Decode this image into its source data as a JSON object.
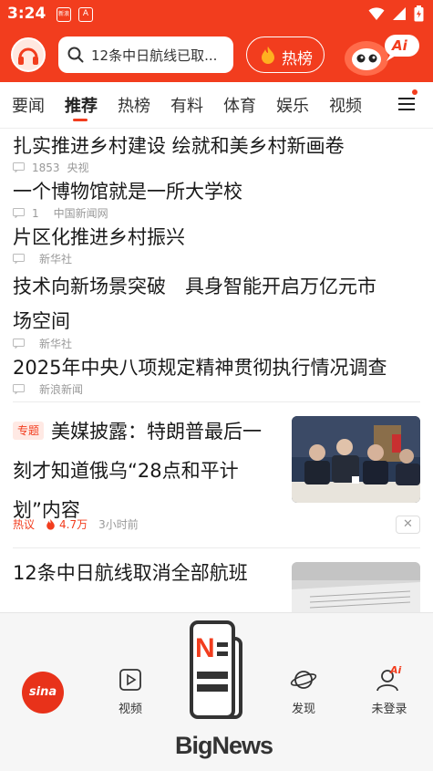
{
  "status_bar": {
    "time": "3:24",
    "app_icon_1": "新浪",
    "app_icon_2": "A"
  },
  "header": {
    "search_text": "12条中日航线已取...",
    "hot_label": "热榜",
    "ai_badge": "Ai"
  },
  "tabs": [
    "要闻",
    "推荐",
    "热榜",
    "有料",
    "体育",
    "娱乐",
    "视频"
  ],
  "active_tab": "推荐",
  "news": [
    {
      "title": "扎实推进乡村建设 绘就和美乡村新画卷",
      "comments": "1853",
      "source": "央视"
    },
    {
      "title": "一个博物馆就是一所大学校",
      "comments": "1",
      "source": "中国新闻网"
    },
    {
      "title": "片区化推进乡村振兴",
      "comments": "",
      "source": "新华社"
    },
    {
      "title_line1": "技术向新场景突破　具身智能开启万亿元市",
      "title_line2": "场空间",
      "comments": "",
      "source": "新华社"
    },
    {
      "title": "2025年中央八项规定精神贯彻执行情况调查",
      "comments": "",
      "source": "新浪新闻"
    }
  ],
  "featured": {
    "tag": "专题",
    "title_line1": "美媒披露：特朗普最后一",
    "title_line2": "刻才知道俄乌“28点和平计",
    "title_line3": "划”内容",
    "meta_label": "热议",
    "heat": "4.7万",
    "time": "3小时前",
    "close": "✕"
  },
  "last_news": {
    "title": "12条中日航线取消全部航班"
  },
  "bottom_nav": {
    "home_logo": "sina",
    "video": "视频",
    "discover": "发现",
    "login": "未登录",
    "login_badge": "Ai",
    "bignews_text": "BigNews"
  },
  "colors": {
    "brand_red": "#f23d1e",
    "background": "#ffffff",
    "nav_bg": "#f6f6f6"
  }
}
